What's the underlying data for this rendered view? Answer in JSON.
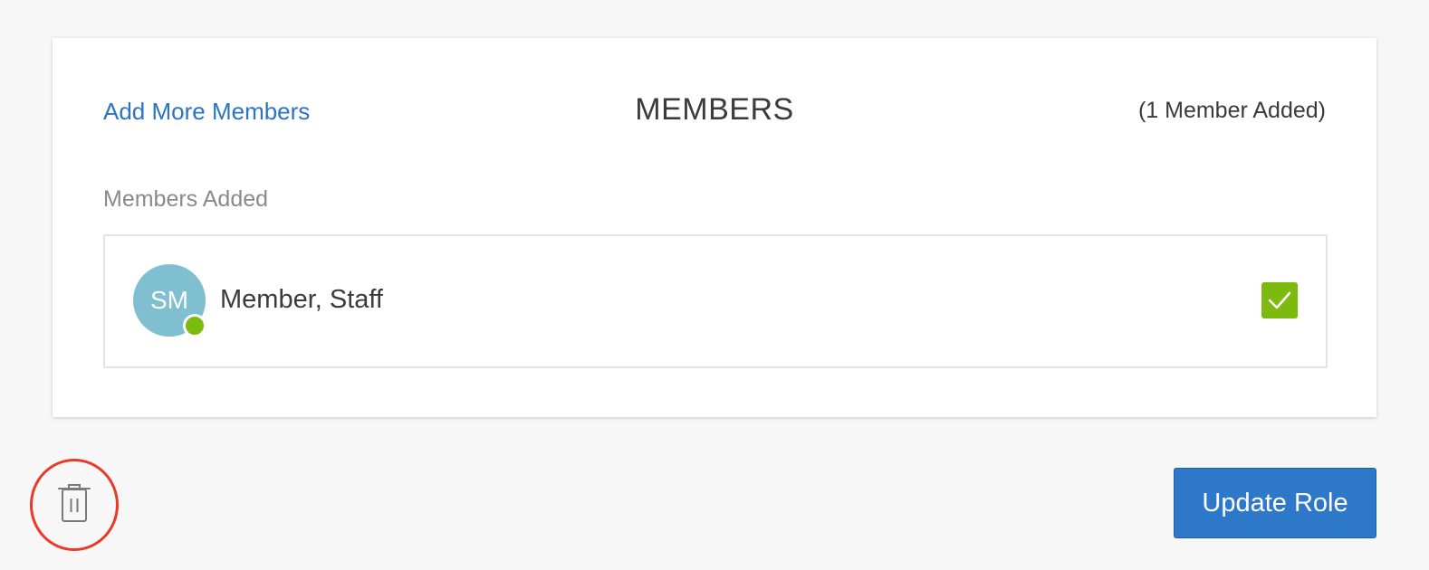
{
  "members_card": {
    "add_link_label": "Add More Members",
    "title": "MEMBERS",
    "count_label": "(1 Member Added)",
    "section_label": "Members Added",
    "members": [
      {
        "initials": "SM",
        "name": "Member, Staff",
        "status": "online",
        "selected": true
      }
    ]
  },
  "actions": {
    "delete_icon": "trash-icon",
    "update_label": "Update Role"
  },
  "colors": {
    "link": "#2a73c5",
    "avatar": "#7fbfd0",
    "online": "#7dba10",
    "checkbox": "#7dba10",
    "primary_button": "#2d78c8",
    "highlight": "#e8392a"
  }
}
